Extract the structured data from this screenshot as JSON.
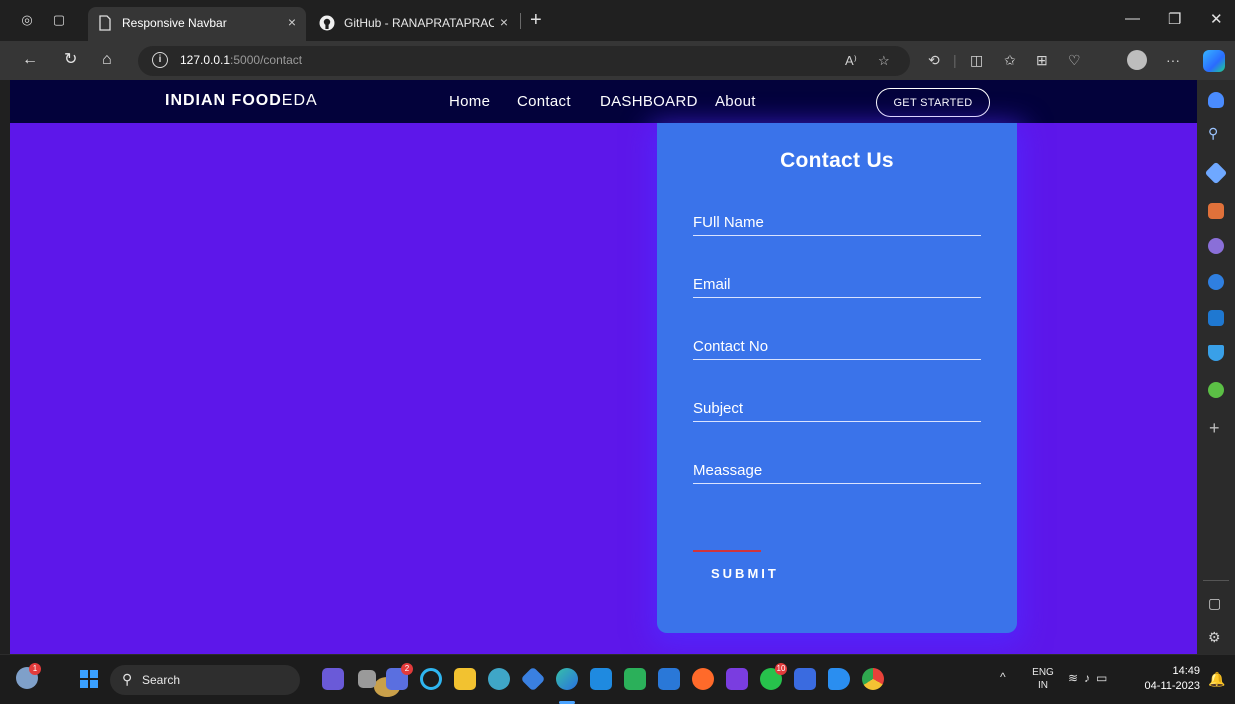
{
  "browser": {
    "tabs": [
      {
        "title": "Responsive Navbar",
        "active": true
      },
      {
        "title": "GitHub - RANAPRATAPRAO/Data",
        "active": false
      }
    ],
    "new_tab_label": "+",
    "close_glyph": "×",
    "window_controls": {
      "minimize": "—",
      "restore": "❐",
      "close": "✕"
    }
  },
  "address_bar": {
    "url_host": "127.0.0.1",
    "url_rest": ":5000/contact",
    "info_glyph": "i",
    "read_aloud": "A⁾",
    "more_glyph": "···"
  },
  "site": {
    "logo_bold": "INDIAN FOOD",
    "logo_thin": "EDA",
    "nav_links": [
      "Home",
      "Contact",
      "DASHBOARD",
      "About"
    ],
    "cta_label": "GET STARTED"
  },
  "contact_form": {
    "title": "Contact Us",
    "fields": [
      "FUll Name",
      "Email",
      "Contact No",
      "Subject",
      "Meassage"
    ],
    "submit_label": "SUBMIT"
  },
  "taskbar": {
    "weather_badge": "1",
    "search_placeholder": "Search",
    "badges": {
      "teams": "2",
      "whatsapp": "10"
    },
    "lang_primary": "ENG",
    "lang_secondary": "IN",
    "time": "14:49",
    "date": "04-11-2023"
  },
  "colors": {
    "page_background": "#5d17ea",
    "site_nav": "#03023b",
    "contact_card": "#3a73ea",
    "submit_accent": "#d0343b"
  }
}
